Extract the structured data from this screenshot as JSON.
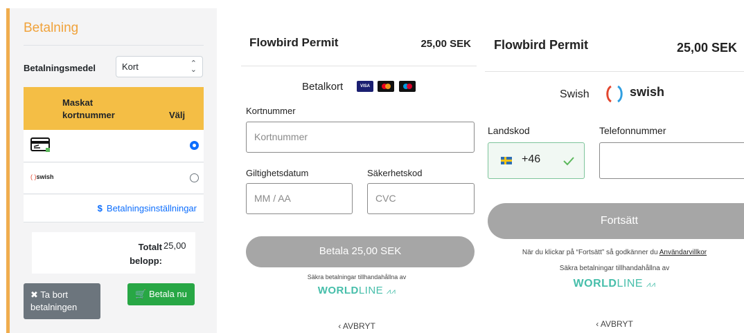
{
  "panel1": {
    "title": "Betalning",
    "payment_method_label": "Betalningsmedel",
    "payment_method_value": "Kort",
    "table_header": {
      "masked": "Maskat kortnummer",
      "masked_line1": "Maskat",
      "masked_line2": "kortnummer",
      "choose": "Välj"
    },
    "rows": [
      {
        "icon": "credit-card-icon",
        "selected": true
      },
      {
        "icon": "swish-logo",
        "label": "swish",
        "selected": false
      }
    ],
    "settings_link": "Betalningsinställningar",
    "total_label_line1": "Totalt",
    "total_label_line2": "belopp:",
    "total_value": "25,00",
    "remove_button_line1": "Ta bort",
    "remove_button_line2": "betalningen",
    "pay_button": "Betala nu",
    "accent_color": "#f0ad4e",
    "header_color": "#f4be45",
    "pay_color": "#28a745"
  },
  "panel2": {
    "title": "Flowbird Permit",
    "price": "25,00 SEK",
    "method_title": "Betalkort",
    "logos": [
      "VISA",
      "mastercard-icon",
      "maestro-icon"
    ],
    "card_number_label": "Kortnummer",
    "card_number_placeholder": "Kortnummer",
    "expiry_label": "Giltighetsdatum",
    "expiry_placeholder": "MM / AA",
    "cvc_label": "Säkerhetskod",
    "cvc_placeholder": "CVC",
    "pay_button": "Betala 25,00 SEK",
    "secure_text": "Säkra betalningar tillhandahållna av",
    "worldline_bold": "WORLD",
    "worldline_light": "LINE",
    "abort": "AVBRYT"
  },
  "panel3": {
    "title": "Flowbird Permit",
    "price": "25,00 SEK",
    "method_title": "Swish",
    "swish_word": "swish",
    "country_code_label": "Landskod",
    "country_code_value": "+46",
    "phone_label": "Telefonnummer",
    "phone_value": "",
    "continue_button": "Fortsätt",
    "terms_prefix": "När du klickar på “Fortsätt” så godkänner du ",
    "terms_link": "Användarvillkor",
    "secure_text": "Säkra betalningar tillhandahållna av",
    "worldline_bold": "WORLD",
    "worldline_light": "LINE",
    "abort": "AVBRYT",
    "success_color": "#7dc49a",
    "brand_color": "#46beaa"
  }
}
